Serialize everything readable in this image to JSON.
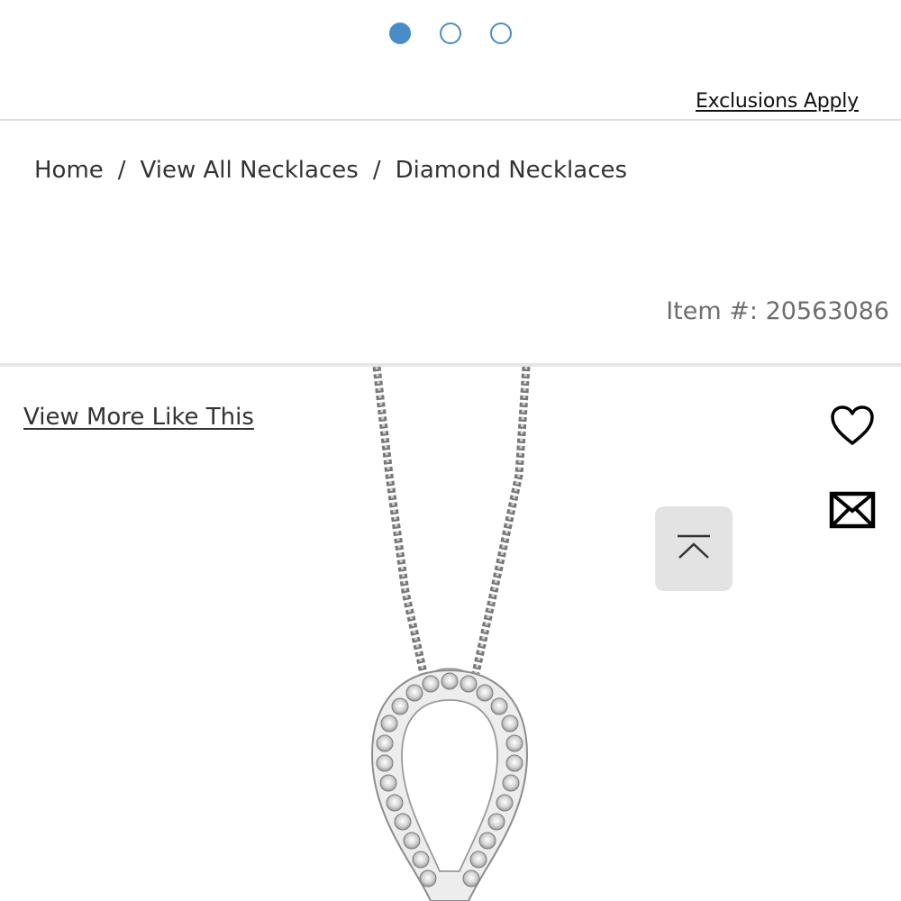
{
  "carousel": {
    "dots": [
      {
        "state": "active"
      },
      {
        "state": "inactive"
      },
      {
        "state": "inactive"
      }
    ],
    "active_index": 0,
    "accent_color": "#4a8cc7"
  },
  "promo": {
    "exclusions_label": "Exclusions Apply"
  },
  "breadcrumb": {
    "items": [
      "Home",
      "View All Necklaces",
      "Diamond Necklaces"
    ],
    "separator": "/"
  },
  "product": {
    "item_label": "Item #:",
    "item_number": "20563086",
    "view_more_label": "View More Like This",
    "image": "diamond-teardrop-pendant-necklace"
  },
  "actions": {
    "wishlist_icon": "heart-icon",
    "email_icon": "envelope-icon",
    "scroll_top_icon": "chevron-up-icon"
  }
}
